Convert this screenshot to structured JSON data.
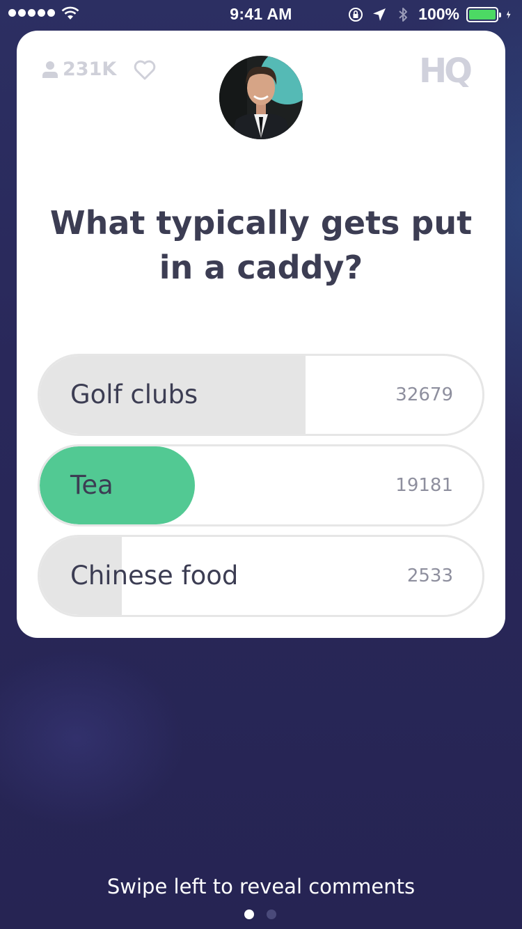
{
  "status_bar": {
    "time": "9:41 AM",
    "battery_percent": "100%",
    "signal_bars": 5,
    "icons": [
      "signal-icon",
      "wifi-icon",
      "orientation-lock-icon",
      "location-icon",
      "bluetooth-icon",
      "battery-icon",
      "charging-icon"
    ]
  },
  "game": {
    "viewer_count": "231K",
    "logo": "HQ",
    "question": "What typically gets put in a caddy?",
    "answers": [
      {
        "label": "Golf clubs",
        "count": "32679",
        "fill_fraction": 0.6,
        "correct": false
      },
      {
        "label": "Tea",
        "count": "19181",
        "fill_fraction": 0.35,
        "correct": true
      },
      {
        "label": "Chinese food",
        "count": "2533",
        "fill_fraction": 0.185,
        "correct": false
      }
    ]
  },
  "footer": {
    "hint": "Swipe left to reveal comments",
    "pages": 2,
    "active_page": 0
  },
  "colors": {
    "background": "#29285a",
    "correct": "#52c993",
    "bar": "#e5e5e5",
    "text": "#3c3d53"
  }
}
